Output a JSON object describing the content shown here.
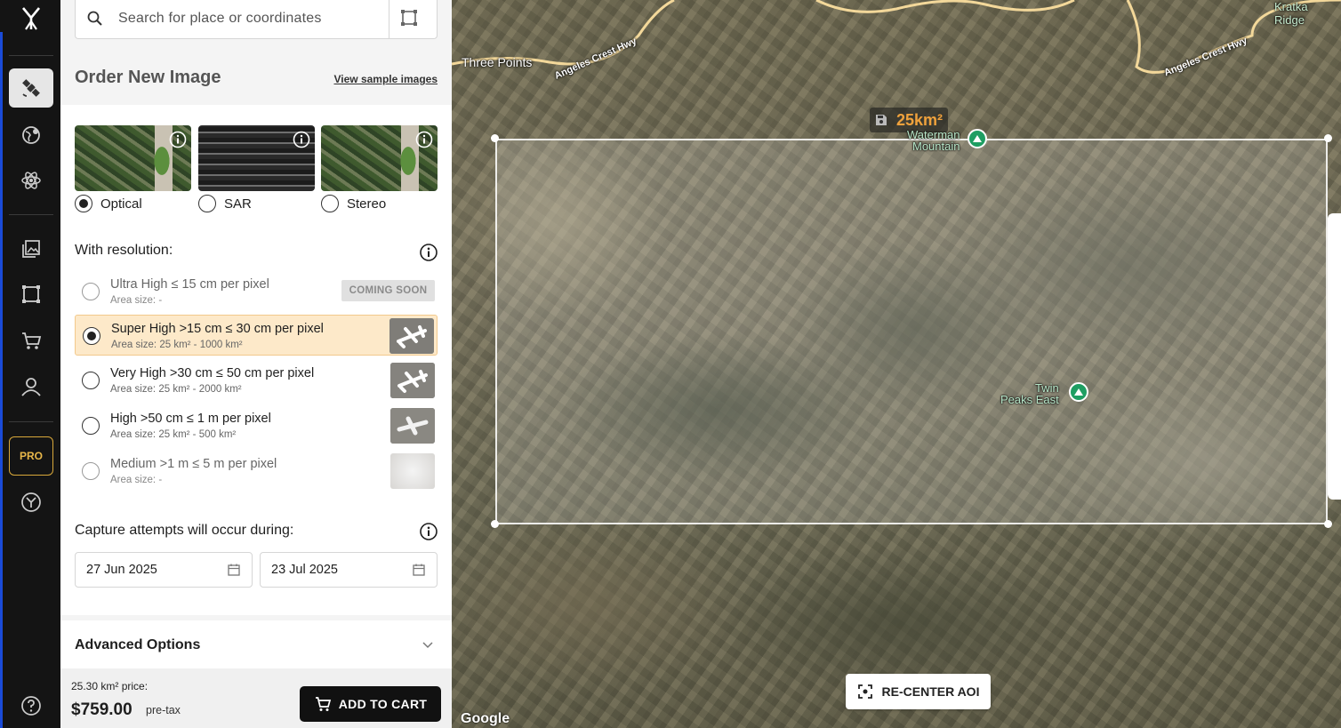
{
  "sidebar": {
    "items": [
      {
        "name": "logo",
        "icon": "yuka-logo-icon"
      },
      {
        "name": "tasking",
        "icon": "satellite-icon",
        "active": true
      },
      {
        "name": "explore",
        "icon": "globe-icon"
      },
      {
        "name": "ai",
        "icon": "atom-icon"
      },
      {
        "name": "library",
        "icon": "images-icon"
      },
      {
        "name": "aoi",
        "icon": "crop-square-icon"
      },
      {
        "name": "cart",
        "icon": "cart-icon"
      },
      {
        "name": "account",
        "icon": "user-icon"
      },
      {
        "name": "pro",
        "label": "PRO"
      },
      {
        "name": "brand",
        "icon": "brand-circle-icon"
      },
      {
        "name": "help",
        "icon": "help-icon"
      }
    ]
  },
  "search": {
    "placeholder": "Search for place or coordinates"
  },
  "order": {
    "title": "Order New Image",
    "sample_link": "View sample images",
    "image_types": [
      {
        "label": "Optical",
        "selected": true
      },
      {
        "label": "SAR",
        "selected": false
      },
      {
        "label": "Stereo",
        "selected": false
      }
    ],
    "resolution_label": "With resolution:",
    "resolutions": [
      {
        "name": "Ultra High ≤ 15 cm per pixel",
        "area": "Area size: -",
        "badge": "COMING SOON",
        "selected": false,
        "disabled": true
      },
      {
        "name": "Super High >15 cm ≤ 30 cm per pixel",
        "area": "Area size: 25 km² - 1000 km²",
        "selected": true
      },
      {
        "name": "Very High >30 cm ≤ 50 cm per pixel",
        "area": "Area size: 25 km² - 2000 km²",
        "selected": false
      },
      {
        "name": "High >50 cm ≤ 1 m per pixel",
        "area": "Area size: 25 km² - 500 km²",
        "selected": false
      },
      {
        "name": "Medium >1 m ≤ 5 m per pixel",
        "area": "Area size: -",
        "selected": false,
        "disabled": true
      }
    ],
    "capture_label": "Capture attempts will occur during:",
    "start_date": "27 Jun 2025",
    "end_date": "23 Jul 2025",
    "advanced_label": "Advanced Options",
    "price_label": "25.30 km² price:",
    "price": "$759.00",
    "pretax": "pre-tax",
    "cart_button": "ADD TO CART"
  },
  "map": {
    "area_label": "25km²",
    "labels": {
      "three_points": "Three Points",
      "angeles_crest_1": "Angeles Crest Hwy",
      "angeles_crest_2": "Angeles Crest Hwy",
      "kratka": "Kratka Ridge",
      "waterman_1": "Waterman",
      "waterman_2": "Mountain",
      "twin_1": "Twin",
      "twin_2": "Peaks East"
    },
    "recenter": "RE-CENTER AOI",
    "attribution": "Google"
  },
  "colors": {
    "accent": "#f0a23c",
    "selected_row": "#fde9c9",
    "rail": "#141414",
    "peak": "#1e9e62"
  }
}
